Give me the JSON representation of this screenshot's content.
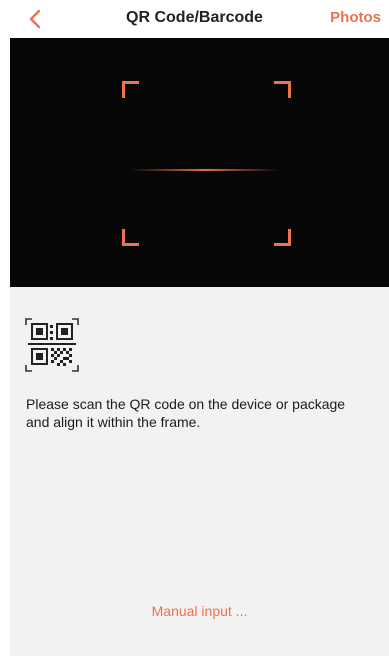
{
  "header": {
    "back_icon": "chevron-left-icon",
    "title": "QR Code/Barcode",
    "photos_label": "Photos"
  },
  "scanner": {
    "accent_color": "#ea7450",
    "background": "#070707"
  },
  "panel": {
    "icon": "qr-code-icon",
    "instruction": "Please scan the QR code on the device or package and align it within the frame.",
    "manual_input_label": "Manual input ...",
    "accent_color": "#e8744d"
  }
}
